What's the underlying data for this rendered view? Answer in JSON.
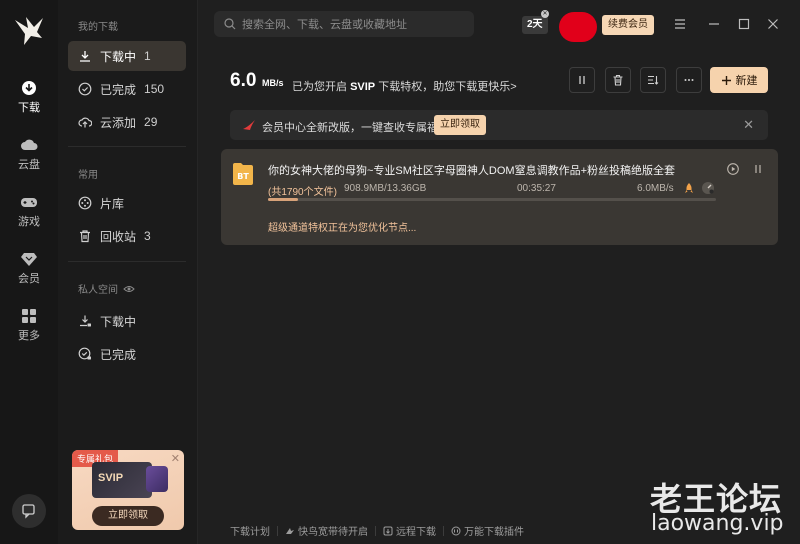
{
  "rail": {
    "items": [
      {
        "label": "下载"
      },
      {
        "label": "云盘"
      },
      {
        "label": "游戏"
      },
      {
        "label": "会员"
      },
      {
        "label": "更多"
      }
    ]
  },
  "sidebar": {
    "section_downloads": "我的下载",
    "items": [
      {
        "label": "下载中",
        "count": "1"
      },
      {
        "label": "已完成",
        "count": "150"
      },
      {
        "label": "云添加",
        "count": "29"
      }
    ],
    "section_common": "常用",
    "common_items": [
      {
        "label": "片库",
        "count": ""
      },
      {
        "label": "回收站",
        "count": "3"
      }
    ],
    "section_private": "私人空间",
    "private_items": [
      {
        "label": "下载中"
      },
      {
        "label": "已完成"
      }
    ],
    "promo": {
      "tag": "专属礼包",
      "card_label": "SVIP",
      "button": "立即领取"
    }
  },
  "topbar": {
    "search_placeholder": "搜索全网、下载、云盘或收藏地址",
    "days_badge": "2天",
    "renew_label": "续费会员"
  },
  "speedbar": {
    "speed_value": "6.0",
    "speed_unit": "MB/s",
    "msg_prefix": "已为您开启",
    "msg_brand": "SVIP",
    "msg_suffix": "下载特权，助您下载更快乐>",
    "new_label": "新建"
  },
  "notice": {
    "text": "会员中心全新改版，一键查收专属福利",
    "claim_label": "立即领取"
  },
  "task": {
    "badge": "BT",
    "name": "你的女神大佬的母狗~专业SM社区字母圈神人DOM窒息调教作品+粉丝投稿绝版全套",
    "files": "(共1790个文件)",
    "size": "908.9MB/13.36GB",
    "elapsed": "00:35:27",
    "rate": "6.0MB/s",
    "progress": 0.066,
    "accel_text": "超级通道特权正在为您优化节点..."
  },
  "footer": {
    "items": [
      "下载计划",
      "快鸟宽带待开启",
      "远程下载",
      "万能下载插件"
    ]
  },
  "watermark": {
    "cn": "老王论坛",
    "en": "laowang.vip"
  },
  "colors": {
    "accent": "#f6d3ad",
    "progress": "#d7a279",
    "avatar": "#e1001a"
  }
}
